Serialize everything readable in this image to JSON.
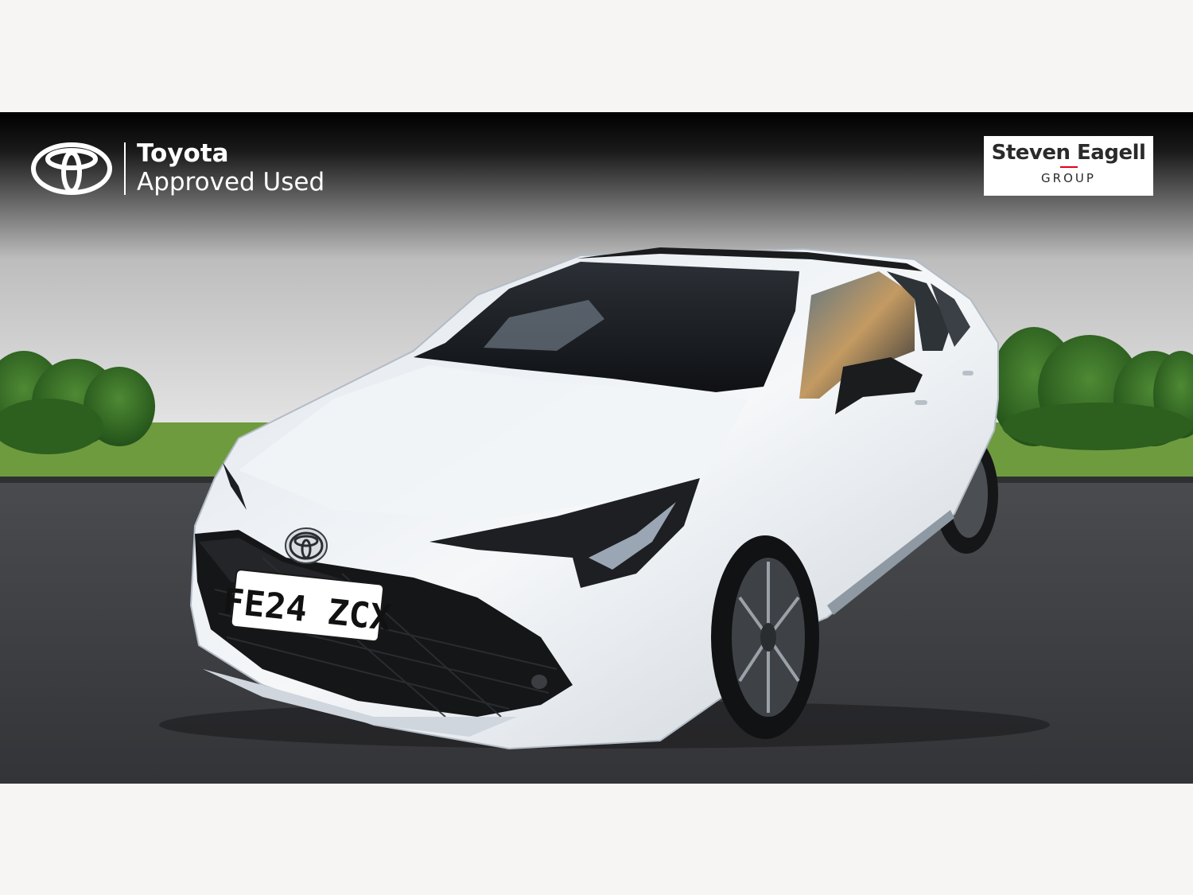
{
  "branding": {
    "brand_name": "Toyota",
    "brand_tagline": "Approved Used",
    "logo_icon": "toyota-ellipses-icon"
  },
  "dealer": {
    "name": "Steven Eagell",
    "sub": "GROUP",
    "accent_color": "#e3001b"
  },
  "vehicle": {
    "registration": "FE24 ZCX",
    "body_color": "#f2f4f6"
  },
  "colors": {
    "background": "#f6f5f3",
    "sky_top": "#000000",
    "sky_bottom": "#e3e3e3",
    "grass": "#6b9a3a",
    "tarmac": "#3a3b3d"
  }
}
